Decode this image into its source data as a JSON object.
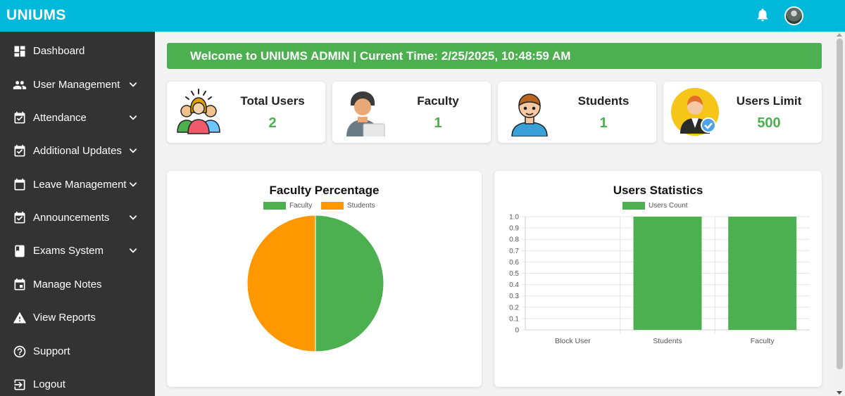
{
  "app": {
    "brand": "UNIUMS"
  },
  "header": {
    "icons": [
      "bell-icon",
      "user-avatar"
    ]
  },
  "sidebar": {
    "items": [
      {
        "label": "Dashboard",
        "icon": "dashboard-icon",
        "has_submenu": false
      },
      {
        "label": "User Management",
        "icon": "people-icon",
        "has_submenu": true
      },
      {
        "label": "Attendance",
        "icon": "calendar-check-icon",
        "has_submenu": true
      },
      {
        "label": "Additional Updates",
        "icon": "calendar-check-icon",
        "has_submenu": true
      },
      {
        "label": "Leave Management",
        "icon": "calendar-icon",
        "has_submenu": true
      },
      {
        "label": "Announcements",
        "icon": "calendar-check-icon",
        "has_submenu": true
      },
      {
        "label": "Exams System",
        "icon": "book-icon",
        "has_submenu": true
      },
      {
        "label": "Manage Notes",
        "icon": "event-icon",
        "has_submenu": false
      },
      {
        "label": "View Reports",
        "icon": "warning-icon",
        "has_submenu": false
      },
      {
        "label": "Support",
        "icon": "help-icon",
        "has_submenu": false
      },
      {
        "label": "Logout",
        "icon": "logout-icon",
        "has_submenu": false
      }
    ]
  },
  "welcome": {
    "text": "Welcome to UNIUMS ADMIN | Current Time: 2/25/2025, 10:48:59 AM"
  },
  "stats": [
    {
      "title": "Total Users",
      "value": "2",
      "icon": "group-users-icon"
    },
    {
      "title": "Faculty",
      "value": "1",
      "icon": "faculty-icon"
    },
    {
      "title": "Students",
      "value": "1",
      "icon": "student-icon"
    },
    {
      "title": "Users Limit",
      "value": "500",
      "icon": "users-limit-icon"
    }
  ],
  "colors": {
    "topbar": "#00b8d9",
    "sidebar": "#333333",
    "accent": "#4caf50",
    "orange": "#ff9800"
  },
  "chart_data": [
    {
      "type": "pie",
      "title": "Faculty Percentage",
      "categories": [
        "Faculty",
        "Students"
      ],
      "values": [
        1,
        1
      ],
      "colors": [
        "#4caf50",
        "#ff9800"
      ],
      "legend": "top"
    },
    {
      "type": "bar",
      "title": "Users Statistics",
      "categories": [
        "Block User",
        "Students",
        "Faculty"
      ],
      "series": [
        {
          "name": "Users Count",
          "values": [
            0,
            1,
            1
          ],
          "color": "#4caf50"
        }
      ],
      "ylim": [
        0,
        1.0
      ],
      "yticks": [
        "0",
        "0.1",
        "0.2",
        "0.3",
        "0.4",
        "0.5",
        "0.6",
        "0.7",
        "0.8",
        "0.9",
        "1.0"
      ],
      "grid": true,
      "legend": "top"
    }
  ]
}
